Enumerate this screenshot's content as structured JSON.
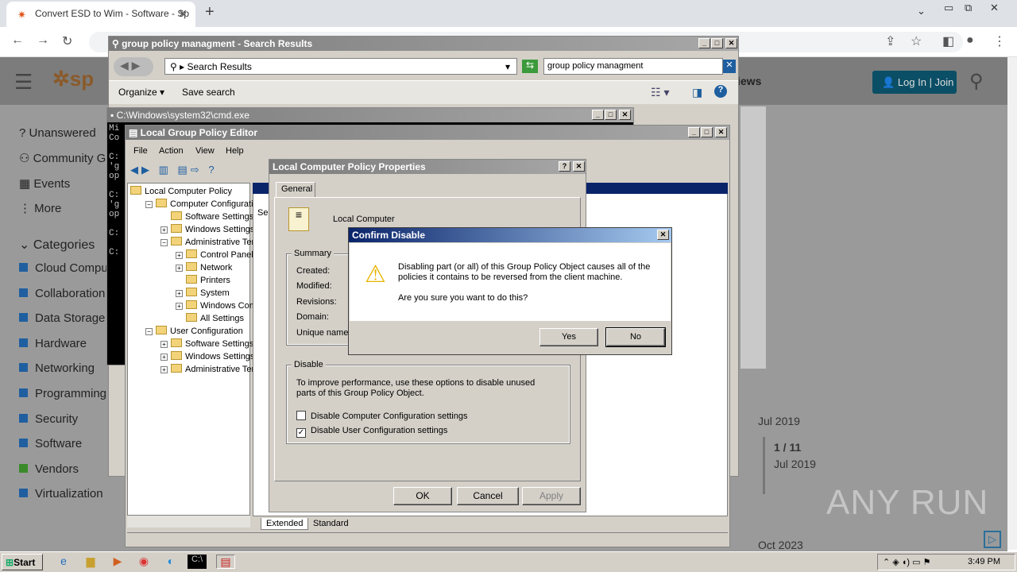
{
  "browser": {
    "tab_title": "Convert ESD to Wim - Software - Sp",
    "new_tab": "+",
    "tab_close": "✕"
  },
  "site": {
    "login": "Log In | Join",
    "views_partial": "iews",
    "logo_partial": "sp",
    "sidebar": [
      "Unanswered",
      "Community G",
      "Events",
      "More"
    ],
    "categories_title": "Categories",
    "categories": [
      {
        "label": "Cloud Compu",
        "color": "#1f5fa0"
      },
      {
        "label": "Collaboration",
        "color": "#1f5fa0"
      },
      {
        "label": "Data Storage",
        "color": "#1f5fa0"
      },
      {
        "label": "Hardware",
        "color": "#1f5fa0"
      },
      {
        "label": "Networking",
        "color": "#1f5fa0"
      },
      {
        "label": "Programming",
        "color": "#1f5fa0"
      },
      {
        "label": "Security",
        "color": "#1f5fa0"
      },
      {
        "label": "Software",
        "color": "#1f5fa0"
      },
      {
        "label": "Vendors",
        "color": "#3a8a2a"
      },
      {
        "label": "Virtualization",
        "color": "#1f5fa0"
      }
    ],
    "timeline": {
      "top_date": "Jul 2019",
      "position": "1 / 11",
      "position_date": "Jul 2019",
      "bottom_date": "Oct 2023"
    },
    "watermark": "ANY RUN"
  },
  "search_window": {
    "title": "group policy managment - Search Results",
    "address": "Search Results",
    "search_value": "group policy managment",
    "organize": "Organize",
    "save_search": "Save search"
  },
  "cmd_window": {
    "title": "C:\\Windows\\system32\\cmd.exe",
    "lines": [
      "Mi",
      "Co",
      "",
      "C:",
      "'g",
      "op",
      "",
      "C:",
      "'g",
      "op",
      "",
      "C:",
      "",
      "C:"
    ]
  },
  "gpedit": {
    "title": "Local Group Policy Editor",
    "menu": [
      "File",
      "Action",
      "View",
      "Help"
    ],
    "tree": [
      {
        "label": "Local Computer Policy",
        "level": 0,
        "exp": ""
      },
      {
        "label": "Computer Configuratio",
        "level": 1,
        "exp": "−"
      },
      {
        "label": "Software Settings",
        "level": 2,
        "exp": ""
      },
      {
        "label": "Windows Settings",
        "level": 2,
        "exp": "+"
      },
      {
        "label": "Administrative Tem",
        "level": 2,
        "exp": "−"
      },
      {
        "label": "Control Panel",
        "level": 3,
        "exp": "+"
      },
      {
        "label": "Network",
        "level": 3,
        "exp": "+"
      },
      {
        "label": "Printers",
        "level": 3,
        "exp": ""
      },
      {
        "label": "System",
        "level": 3,
        "exp": "+"
      },
      {
        "label": "Windows Comp",
        "level": 3,
        "exp": "+"
      },
      {
        "label": "All Settings",
        "level": 3,
        "exp": ""
      },
      {
        "label": "User Configuration",
        "level": 1,
        "exp": "−"
      },
      {
        "label": "Software Settings",
        "level": 2,
        "exp": "+"
      },
      {
        "label": "Windows Settings",
        "level": 2,
        "exp": "+"
      },
      {
        "label": "Administrative Tem",
        "level": 2,
        "exp": "+"
      }
    ],
    "right_partial": "Se",
    "tabs": [
      "Extended",
      "Standard"
    ]
  },
  "props": {
    "title": "Local Computer Policy Properties",
    "tab": "General",
    "name": "Local Computer",
    "summary_label": "Summary",
    "summary_fields": [
      "Created:",
      "Modified:",
      "Revisions:",
      "Domain:",
      "Unique name:"
    ],
    "disable_label": "Disable",
    "disable_text": "To improve performance, use these options to disable unused parts of this Group Policy Object.",
    "opt1": "Disable Computer Configuration settings",
    "opt1_checked": false,
    "opt2": "Disable User Configuration settings",
    "opt2_checked": true,
    "ok": "OK",
    "cancel": "Cancel",
    "apply": "Apply"
  },
  "confirm": {
    "title": "Confirm Disable",
    "message": "Disabling part (or all) of this Group Policy Object causes all of the policies it contains to be reversed from the client machine.",
    "question": "Are you sure you want to do this?",
    "yes": "Yes",
    "no": "No"
  },
  "taskbar": {
    "start": "Start",
    "time": "3:49 PM"
  }
}
